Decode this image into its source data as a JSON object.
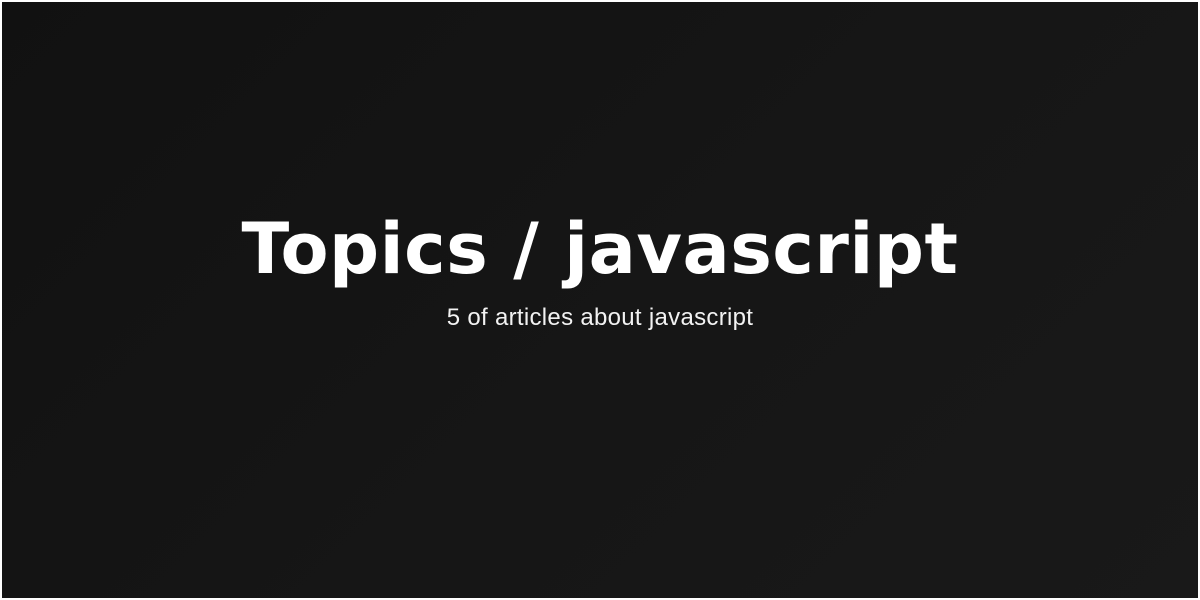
{
  "card": {
    "title": "Topics / javascript",
    "subtitle": "5 of articles about javascript"
  },
  "colors": {
    "background": "#141414",
    "text": "#ffffff",
    "frame": "#ffffff"
  }
}
